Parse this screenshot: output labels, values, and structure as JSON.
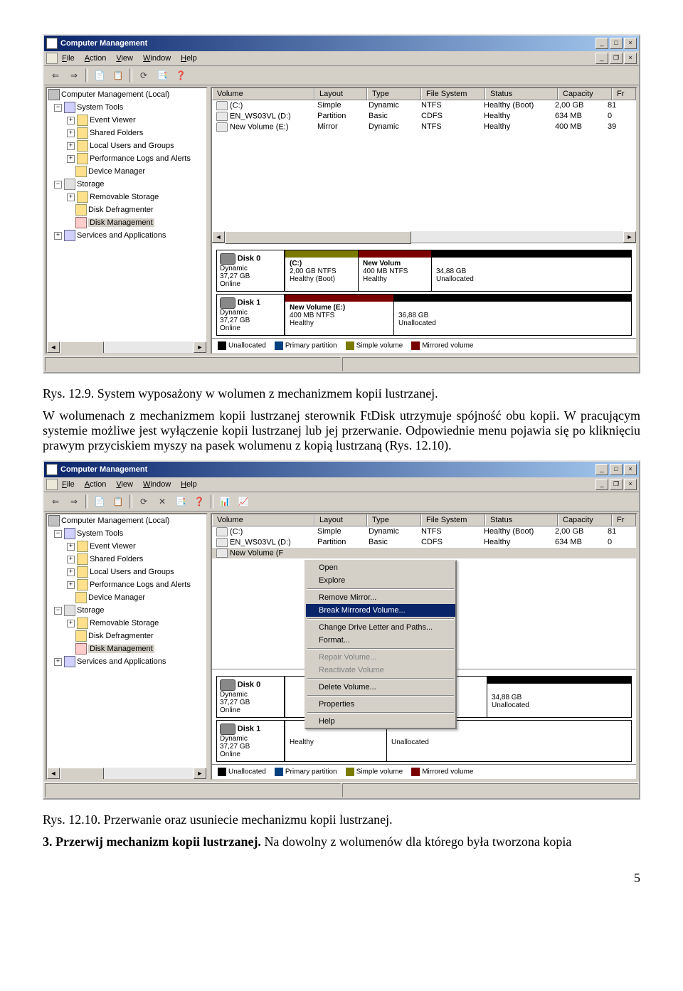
{
  "figure1_caption": "Rys. 12.9. System wyposażony w wolumen z mechanizmem kopii lustrzanej.",
  "para1": "W wolumenach z mechanizmem kopii lustrzanej sterownik FtDisk utrzymuje spójność obu kopii. W pracującym systemie możliwe jest wyłączenie kopii lustrzanej lub jej przerwanie. Odpowiednie menu pojawia się po kliknięciu prawym przyciskiem myszy na pasek wolumenu z kopią lustrzaną (Rys. 12.10).",
  "figure2_caption": "Rys. 12.10. Przerwanie oraz usuniecie mechanizmu kopii lustrzanej.",
  "para2_prefix": "3. Przerwij mechanizm kopii lustrzanej.",
  "para2_rest": " Na dowolny z wolumenów dla którego była tworzona kopia",
  "pagenum": "5",
  "cm": {
    "title": "Computer Management",
    "menu": {
      "file": "File",
      "action": "Action",
      "view": "View",
      "window": "Window",
      "help": "Help"
    },
    "tree": {
      "root": "Computer Management (Local)",
      "systools": "System Tools",
      "ev": "Event Viewer",
      "sf": "Shared Folders",
      "lug": "Local Users and Groups",
      "pla": "Performance Logs and Alerts",
      "dm": "Device Manager",
      "storage": "Storage",
      "rs": "Removable Storage",
      "dd": "Disk Defragmenter",
      "diskmgmt": "Disk Management",
      "sa": "Services and Applications"
    },
    "cols": {
      "volume": "Volume",
      "layout": "Layout",
      "type": "Type",
      "fs": "File System",
      "status": "Status",
      "capacity": "Capacity",
      "fr": "Fr"
    },
    "vols": [
      {
        "name": "(C:)",
        "layout": "Simple",
        "type": "Dynamic",
        "fs": "NTFS",
        "status": "Healthy (Boot)",
        "cap": "2,00 GB",
        "fr": "81"
      },
      {
        "name": "EN_WS03VL (D:)",
        "layout": "Partition",
        "type": "Basic",
        "fs": "CDFS",
        "status": "Healthy",
        "cap": "634 MB",
        "fr": "0"
      },
      {
        "name": "New Volume (E:)",
        "layout": "Mirror",
        "type": "Dynamic",
        "fs": "NTFS",
        "status": "Healthy",
        "cap": "400 MB",
        "fr": "39"
      }
    ],
    "disk0": {
      "name": "Disk 0",
      "type": "Dynamic",
      "size": "37,27 GB",
      "state": "Online",
      "v1": {
        "name": "(C:)",
        "info": "2,00 GB NTFS",
        "st": "Healthy (Boot)"
      },
      "v2": {
        "name": "New Volum",
        "info": "400 MB NTFS",
        "st": "Healthy"
      },
      "v3": {
        "name": "",
        "info": "34,88 GB",
        "st": "Unallocated"
      }
    },
    "disk1": {
      "name": "Disk 1",
      "type": "Dynamic",
      "size": "37,27 GB",
      "state": "Online",
      "v1": {
        "name": "New Volume  (E:)",
        "info": "400 MB NTFS",
        "st": "Healthy"
      },
      "v2": {
        "name": "",
        "info": "36,88 GB",
        "st": "Unallocated"
      }
    },
    "legend": {
      "un": "Unallocated",
      "pp": "Primary partition",
      "sv": "Simple volume",
      "mv": "Mirrored volume"
    },
    "ctx": {
      "open": "Open",
      "explore": "Explore",
      "removemirror": "Remove Mirror...",
      "breakmirror": "Break Mirrored Volume...",
      "changeletter": "Change Drive Letter and Paths...",
      "format": "Format...",
      "repair": "Repair Volume...",
      "reactivate": "Reactivate Volume",
      "delete": "Delete Volume...",
      "properties": "Properties",
      "help": "Help"
    },
    "row3short": "New Volume (F"
  }
}
